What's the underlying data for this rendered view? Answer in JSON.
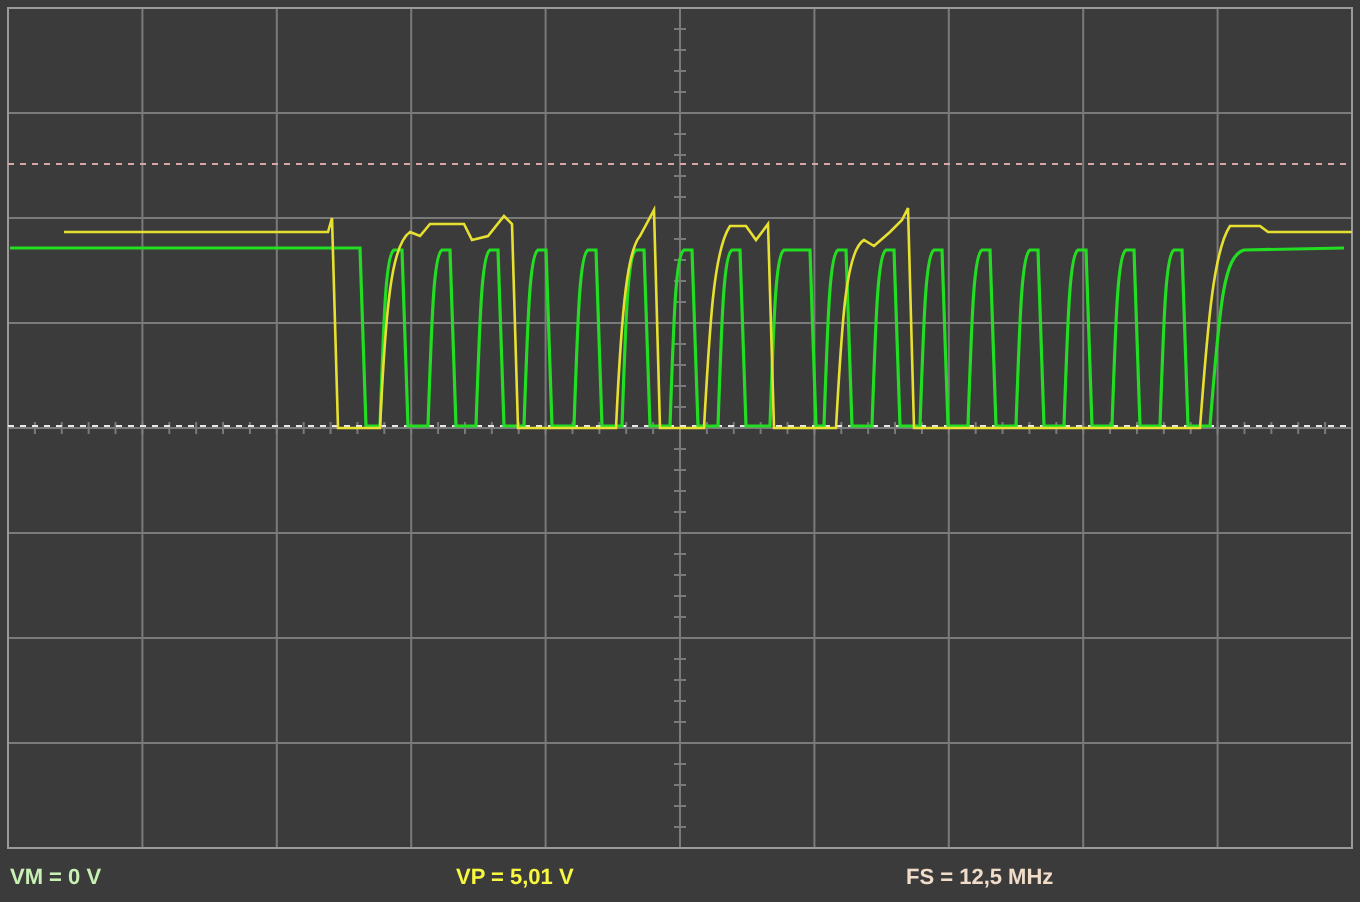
{
  "status_bar": {
    "readouts": [
      {
        "text": "VM = 0 V",
        "color": "#c8f0b4"
      },
      {
        "text": "VP = 5,01 V",
        "color": "#f8f840"
      },
      {
        "text": "FS = 12,5 MHz",
        "color": "#f0dcc8"
      }
    ]
  }
}
